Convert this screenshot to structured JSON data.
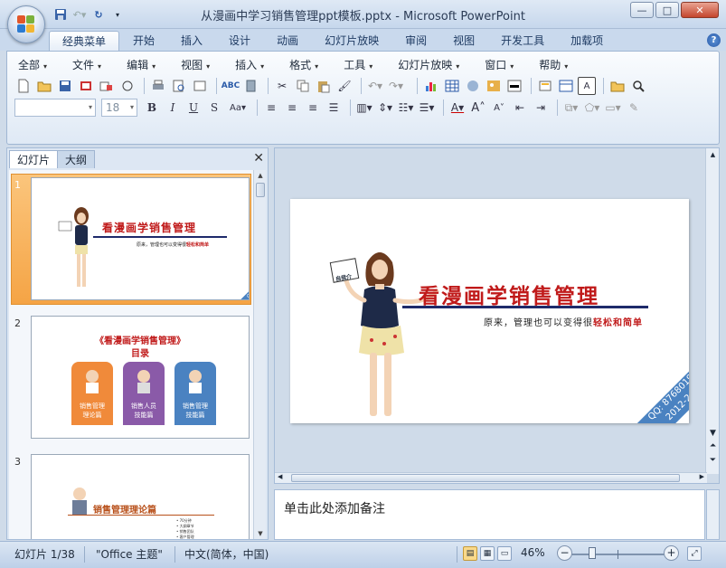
{
  "window": {
    "title": "从漫画中学习销售管理ppt模板.pptx - Microsoft PowerPoint",
    "controls": {
      "minimize": "—",
      "maximize": "□",
      "close": "✕"
    }
  },
  "ribbon": {
    "tabs": [
      "经典菜单",
      "开始",
      "插入",
      "设计",
      "动画",
      "幻灯片放映",
      "审阅",
      "视图",
      "开发工具",
      "加载项"
    ],
    "active_tab": "经典菜单",
    "menus": [
      "全部",
      "文件",
      "编辑",
      "视图",
      "插入",
      "格式",
      "工具",
      "幻灯片放映",
      "窗口",
      "帮助"
    ],
    "font_name": "",
    "font_size": "18"
  },
  "left_panel": {
    "tabs": [
      "幻灯片",
      "大纲"
    ],
    "active_tab": "幻灯片",
    "slide_numbers": [
      "1",
      "2",
      "3"
    ]
  },
  "slides": {
    "s1": {
      "title": "看漫画学销售管理",
      "subtitle_plain": "原来，管理也可以变得很",
      "subtitle_bold": "轻松和简单",
      "sign": "自我介",
      "corner_line1": "QQ: 876801960",
      "corner_line2": "2012-2-28"
    },
    "s2": {
      "title": "《看漫画学销售管理》",
      "subtitle": "目录",
      "cards": [
        "销售管理\n理论篇",
        "销售人员\n技能篇",
        "销售管理\n技能篇"
      ]
    },
    "s3": {
      "title": "销售管理理论篇",
      "items": [
        "• 70分钟",
        "• 大纲章节",
        "• 销售团队",
        "• 客户管理"
      ]
    }
  },
  "notes": {
    "placeholder": "单击此处添加备注"
  },
  "status": {
    "slide": "幻灯片 1/38",
    "theme": "\"Office 主题\"",
    "language": "中文(简体，中国)",
    "zoom": "46%",
    "zoom_percent": 46
  },
  "colors": {
    "accent_blue": "#4a82c1",
    "title_red": "#c01a1a",
    "selected_thumb": "#f5a445",
    "card_orange": "#f08a3a",
    "card_purple": "#8a5aa8",
    "card_blue": "#4a82c1"
  }
}
